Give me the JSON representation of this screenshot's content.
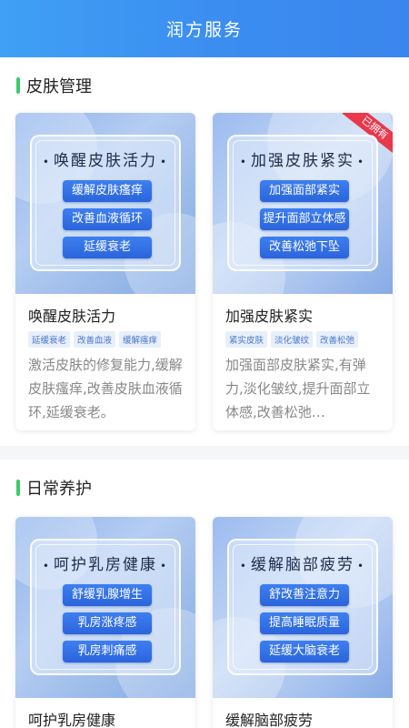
{
  "header": {
    "title": "润方服务"
  },
  "sections": [
    {
      "title": "皮肤管理",
      "cards": [
        {
          "poster_title": "唤醒皮肤活力",
          "pills": [
            "缓解皮肤瘙痒",
            "改善血液循环",
            "延缓衰老"
          ],
          "title": "唤醒皮肤活力",
          "tags": [
            "延缓衰老",
            "改善血液",
            "缓解瘙痒"
          ],
          "desc": "激活皮肤的修复能力,缓解皮肤瘙痒,改善皮肤血液循环,延缓衰老。"
        },
        {
          "poster_title": "加强皮肤紧实",
          "pills": [
            "加强面部紧实",
            "提升面部立体感",
            "改善松弛下坠"
          ],
          "badge": "已拥有",
          "title": "加强皮肤紧实",
          "tags": [
            "紧实皮肤",
            "淡化皱纹",
            "改善松弛"
          ],
          "desc": "加强面部皮肤紧实,有弹力,淡化皱纹,提升面部立体感,改善松弛…"
        }
      ]
    },
    {
      "title": "日常养护",
      "cards": [
        {
          "poster_title": "呵护乳房健康",
          "pills": [
            "舒缓乳腺增生",
            "乳房涨疼感",
            "乳房刺痛感"
          ],
          "title": "呵护乳房健康"
        },
        {
          "poster_title": "缓解脑部疲劳",
          "pills": [
            "舒改善注意力",
            "提高睡眠质量",
            "延缓大脑衰老"
          ],
          "title": "缓解脑部疲劳"
        }
      ]
    }
  ],
  "colors": {
    "header": "#3b8df0",
    "accent": "#3ec96a",
    "pill": "#2f6de4",
    "badge": "#e8384a"
  }
}
